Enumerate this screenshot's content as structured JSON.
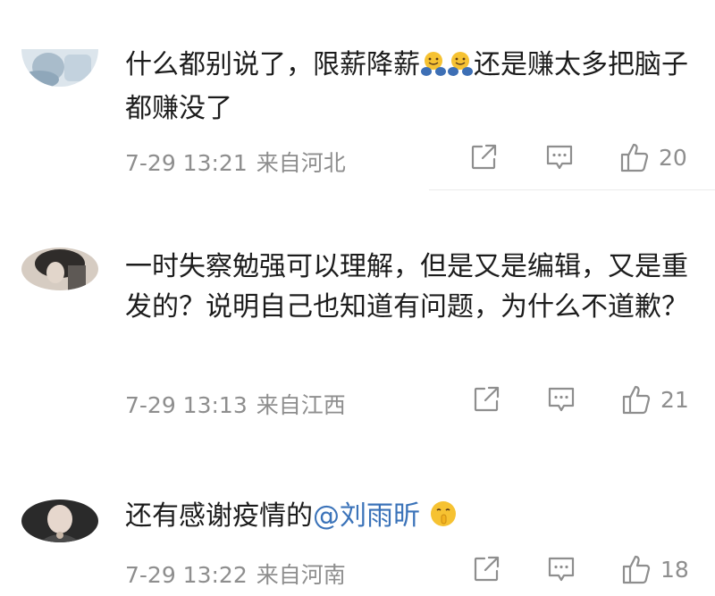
{
  "comments": [
    {
      "text_before": "什么都别说了，限薪降薪",
      "text_after": "还是赚太多把脑子都赚没了",
      "time": "7-29 13:21",
      "location": "来自河北",
      "likes": "20",
      "emoji": [
        "hug-emoji",
        "hug-emoji"
      ],
      "avatar_colors": [
        "#c8d6e2",
        "#9fb4c6",
        "#e8eef3"
      ]
    },
    {
      "text": "一时失察勉强可以理解，但是又是编辑，又是重发的？说明自己也知道有问题，为什么不道歉？",
      "time": "7-29 13:13",
      "location": "来自江西",
      "likes": "21",
      "avatar_colors": [
        "#3a3a3a",
        "#d8cfc4",
        "#6e6a66"
      ]
    },
    {
      "text_before": "还有感谢疫情的",
      "mention": "@刘雨昕",
      "time": "7-29 13:22",
      "location": "来自河南",
      "likes": "18",
      "emoji": [
        "shush-emoji"
      ],
      "avatar_colors": [
        "#1e1e1e",
        "#e9d9cf",
        "#555555"
      ]
    }
  ]
}
